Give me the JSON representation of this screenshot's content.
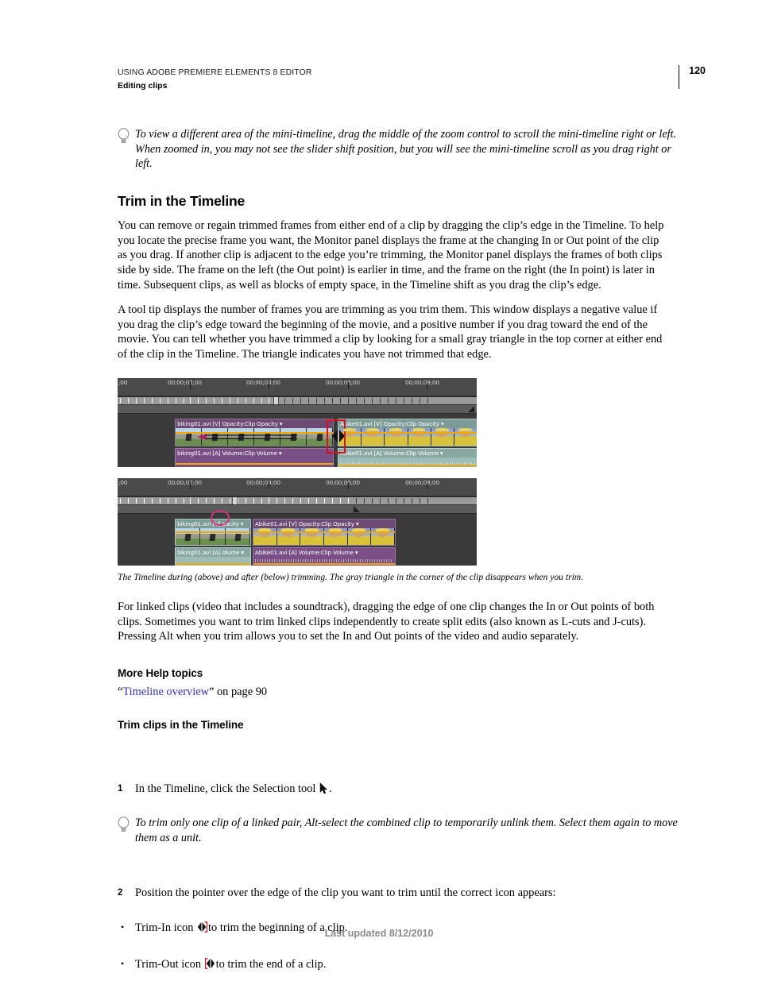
{
  "header": {
    "book_title": "USING ADOBE PREMIERE ELEMENTS 8 EDITOR",
    "section": "Editing clips",
    "page_number": "120"
  },
  "tip_top": {
    "icon": "lightbulb-icon",
    "text": "To view a different area of the mini-timeline, drag the middle of the zoom control to scroll the mini-timeline right or left. When zoomed in, you may not see the slider shift position, but you will see the mini-timeline scroll as you drag right or left."
  },
  "heading_main": "Trim in the Timeline",
  "paragraphs": {
    "p1": "You can remove or regain trimmed frames from either end of a clip by dragging the clip’s edge in the Timeline. To help you locate the precise frame you want, the Monitor panel displays the frame at the changing In or Out point of the clip as you drag. If another clip is adjacent to the edge you’re trimming, the Monitor panel displays the frames of both clips side by side. The frame on the left (the Out point) is earlier in time, and the frame on the right (the In point) is later in time. Subsequent clips, as well as blocks of empty space, in the Timeline shift as you drag the clip’s edge.",
    "p2": "A tool tip displays the number of frames you are trimming as you trim them. This window displays a negative value if you drag the clip’s edge toward the beginning of the movie, and a positive number if you drag toward the end of the movie. You can tell whether you have trimmed a clip by looking for a small gray triangle in the top corner at either end of the clip in the Timeline. The triangle indicates you have not trimmed that edge.",
    "p3": "For linked clips (video that includes a soundtrack), dragging the edge of one clip changes the In or Out points of both clips. Sometimes you want to trim linked clips independently to create split edits (also known as L-cuts and J-cuts). Pressing Alt when you trim allows you to set the In and Out points of the video and audio separately."
  },
  "figure": {
    "caption": "The Timeline during (above) and after (below) trimming. The gray triangle in the corner of the clip disappears when you trim.",
    "timeline_during": {
      "ruler_labels": [
        ";00",
        "00;00;02;00",
        "00;00;04;00",
        "00;00;06;00",
        "00;00;08;00"
      ],
      "clips": [
        {
          "name": "biking01.avi [V]",
          "property": "Opacity:Clip Opacity",
          "track": "video"
        },
        {
          "name": "Abike01.avi [V]",
          "property": "Opacity:Clip Opacity",
          "track": "video"
        },
        {
          "name": "biking01.avi [A]",
          "property": "Volume:Clip Volume",
          "track": "audio"
        },
        {
          "name": "Abike01.avi [A]",
          "property": "Volume:Clip Volume",
          "track": "audio"
        }
      ],
      "annotations": [
        "red-highlight-box",
        "drag-arrow",
        "trim-cursor"
      ]
    },
    "timeline_after": {
      "ruler_labels": [
        ";00",
        "00;00;02;00",
        "00;00;04;00",
        "00;00;06;00",
        "00;00;08;00"
      ],
      "clips": [
        {
          "name": "biking01.avi [V]",
          "property": "pacity",
          "track": "video"
        },
        {
          "name": "Abike01.avi [V]",
          "property": "Opacity:Clip Opacity",
          "track": "video"
        },
        {
          "name": "biking01.avi [A]",
          "property": "olume",
          "track": "audio"
        },
        {
          "name": "Abike01.avi [A]",
          "property": "Volume:Clip Volume",
          "track": "audio"
        }
      ],
      "annotations": [
        "pink-ellipse-highlight"
      ]
    }
  },
  "more_help": {
    "heading": "More Help topics",
    "link_open_quote": "“",
    "link_text": "Timeline overview",
    "link_close_quote": "”",
    "link_suffix": " on page 90",
    "link_color": "#3333cc"
  },
  "procedure": {
    "heading": "Trim clips in the Timeline",
    "step1_num": "1",
    "step1_pre": "In the Timeline, click the Selection tool",
    "step1_icon": "selection-arrow-icon",
    "step1_post": ".",
    "tip_text": "To trim only one clip of a linked pair, Alt-select the combined clip to temporarily unlink them. Select them again to move them as a unit.",
    "step2_num": "2",
    "step2_text": "Position the pointer over the edge of the clip you want to trim until the correct icon appears:",
    "bullets": [
      {
        "marker": "•",
        "pre": "Trim-In icon",
        "icon": "trim-in-icon",
        "post": "to trim the beginning of a clip."
      },
      {
        "marker": "•",
        "pre": "Trim-Out icon",
        "icon": "trim-out-icon",
        "post": "to trim the end of a clip."
      }
    ]
  },
  "footer": {
    "text": "Last updated 8/12/2010"
  }
}
